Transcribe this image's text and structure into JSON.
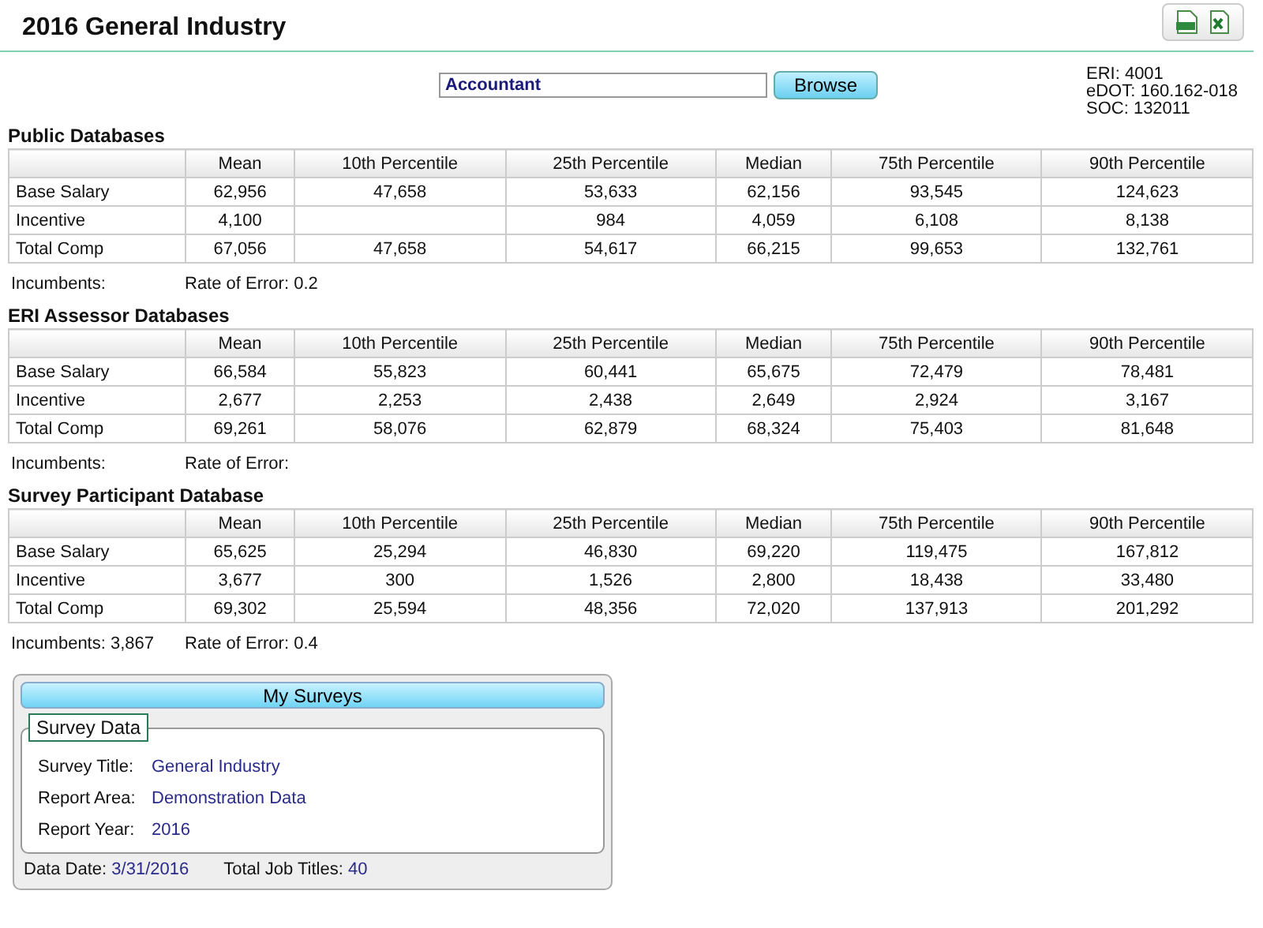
{
  "title": "2016 General Industry",
  "toolbar": {
    "buttons": [
      {
        "kind": "pdf"
      },
      {
        "kind": "excel"
      }
    ]
  },
  "search": {
    "value": "Accountant",
    "button": "Browse"
  },
  "codes": [
    "ERI: 4001",
    "eDOT: 160.162-018",
    "SOC: 132011"
  ],
  "sections": [
    {
      "title": "Public Databases",
      "columns": [
        "Mean",
        "10th Percentile",
        "25th Percentile",
        "Median",
        "75th Percentile",
        "90th Percentile"
      ],
      "rows": [
        {
          "label": "Base Salary",
          "cells": [
            "62,956",
            "47,658",
            "53,633",
            "62,156",
            "93,545",
            "124,623"
          ]
        },
        {
          "label": "Incentive",
          "cells": [
            "4,100",
            null,
            "984",
            "4,059",
            "6,108",
            "8,138"
          ]
        },
        {
          "label": "Total Comp",
          "cells": [
            "67,056",
            "47,658",
            "54,617",
            "66,215",
            "99,653",
            "132,761"
          ]
        }
      ],
      "footer": [
        "Incumbents:",
        "Rate of Error: 0.2"
      ]
    },
    {
      "title": "ERI Assessor Databases",
      "columns": [
        "Mean",
        "10th Percentile",
        "25th Percentile",
        "Median",
        "75th Percentile",
        "90th Percentile"
      ],
      "rows": [
        {
          "label": "Base Salary",
          "cells": [
            "66,584",
            "55,823",
            "60,441",
            "65,675",
            "72,479",
            "78,481"
          ]
        },
        {
          "label": "Incentive",
          "cells": [
            "2,677",
            "2,253",
            "2,438",
            "2,649",
            "2,924",
            "3,167"
          ]
        },
        {
          "label": "Total Comp",
          "cells": [
            "69,261",
            "58,076",
            "62,879",
            "68,324",
            "75,403",
            "81,648"
          ]
        }
      ],
      "footer": [
        "Incumbents:",
        "Rate of Error:"
      ]
    },
    {
      "title": "Survey Participant Database",
      "columns": [
        "Mean",
        "10th Percentile",
        "25th Percentile",
        "Median",
        "75th Percentile",
        "90th Percentile"
      ],
      "rows": [
        {
          "label": "Base Salary",
          "cells": [
            "65,625",
            "25,294",
            "46,830",
            "69,220",
            "119,475",
            "167,812"
          ]
        },
        {
          "label": "Incentive",
          "cells": [
            "3,677",
            "300",
            "1,526",
            "2,800",
            "18,438",
            "33,480"
          ]
        },
        {
          "label": "Total Comp",
          "cells": [
            "69,302",
            "25,594",
            "48,356",
            "72,020",
            "137,913",
            "201,292"
          ]
        }
      ],
      "footer": [
        "Incumbents: 3,867",
        "Rate of Error: 0.4"
      ]
    }
  ],
  "surveys": {
    "header": "My Surveys",
    "legend": "Survey Data",
    "fields": [
      {
        "label": "Survey Title:",
        "value": "General Industry"
      },
      {
        "label": "Report Area:",
        "value": "Demonstration Data"
      },
      {
        "label": "Report Year:",
        "value": "2016"
      }
    ],
    "footer": [
      {
        "label": "Data Date:",
        "value": "3/31/2016"
      },
      {
        "label": "Total Job Titles:",
        "value": "40"
      }
    ]
  }
}
